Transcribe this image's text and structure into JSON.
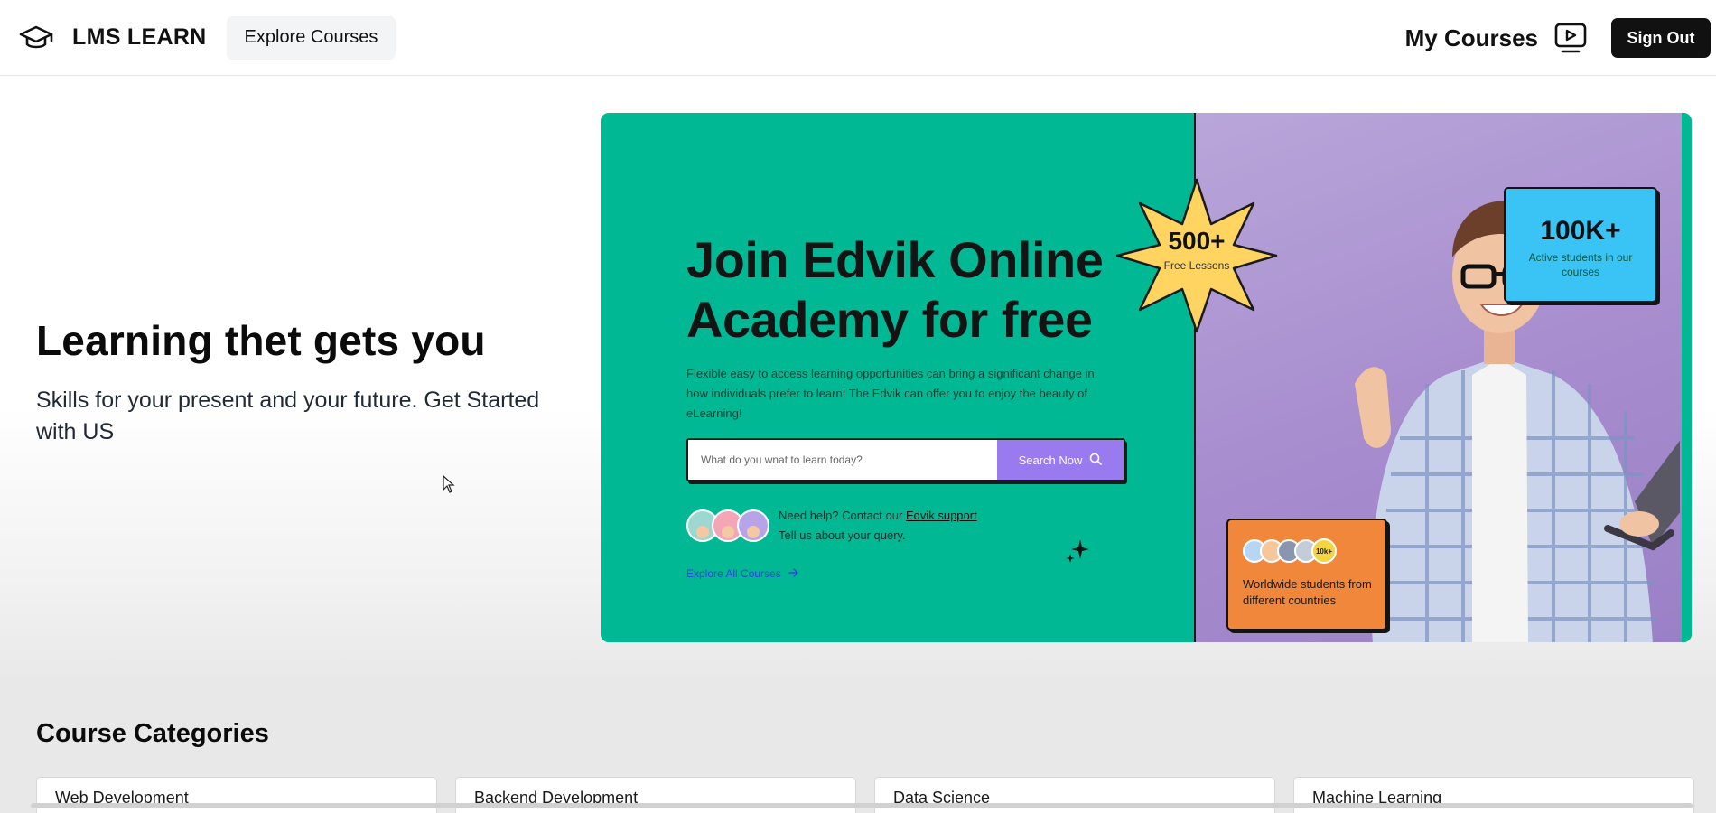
{
  "header": {
    "brand": "LMS LEARN",
    "brand_icon": "graduation-cap-icon",
    "explore_label": "Explore Courses",
    "my_courses_label": "My Courses",
    "my_courses_icon": "video-play-icon",
    "sign_out_label": "Sign Out"
  },
  "hero": {
    "title": "Learning thet gets you",
    "subtitle": "Skills for your present and your future. Get Started with US"
  },
  "banner": {
    "title": "Join Edvik Online Academy for free",
    "description": "Flexible easy to access learning opportunities can bring a significant change in how individuals prefer to learn! The Edvik can offer you to enjoy the beauty of eLearning!",
    "search_placeholder": "What do you wnat to learn today?",
    "search_button": "Search Now",
    "support_prefix": "Need help? Contact our",
    "support_link": "Edvik support",
    "support_line2": "Tell us about your query.",
    "explore_all": "Explore All Courses",
    "badge_number": "500+",
    "badge_label": "Free Lessons",
    "stat_students_number": "100K+",
    "stat_students_label": "Active students in our courses",
    "stat_world_count": "10k+",
    "stat_world_label": "Worldwide students from different countries",
    "colors": {
      "green": "#00b994",
      "purple": "#a88ecf",
      "search_button": "#9a7bef",
      "blue_card": "#3ac4f5",
      "orange_card": "#f0873a",
      "badge": "#ffd460"
    }
  },
  "categories": {
    "title": "Course Categories",
    "items": [
      "Web Development",
      "Backend Development",
      "Data Science",
      "Machine Learning"
    ]
  }
}
